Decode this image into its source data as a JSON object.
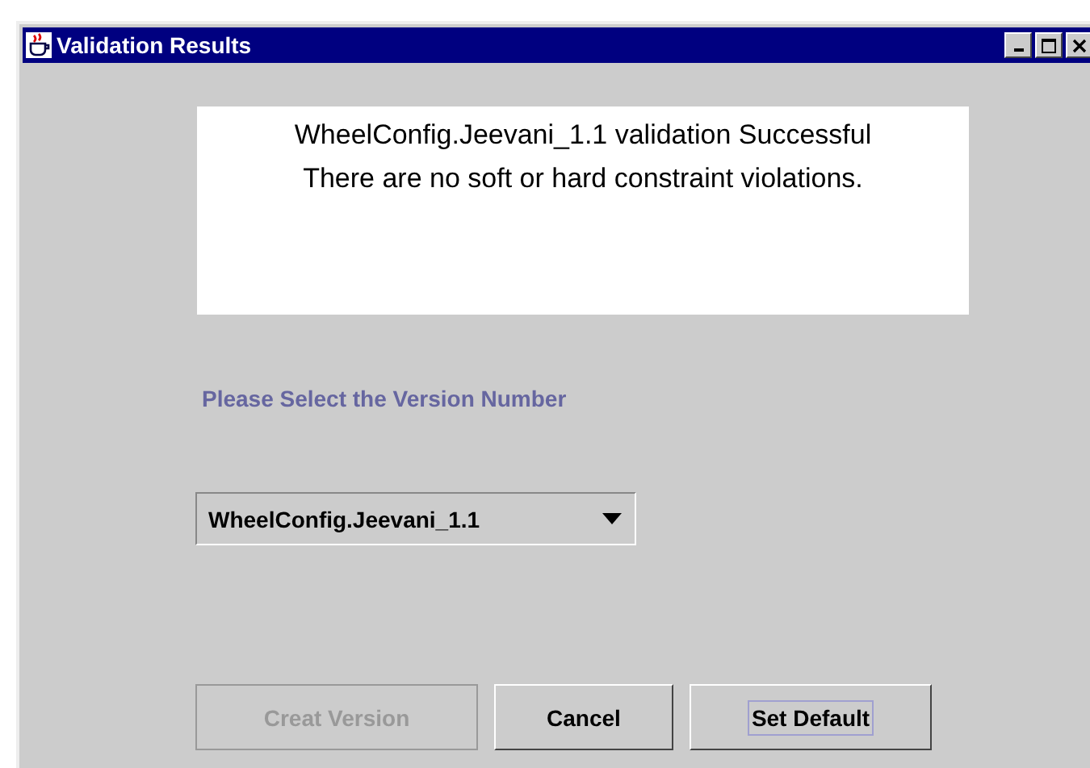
{
  "window": {
    "title": "Validation Results"
  },
  "message": [
    "WheelConfig.Jeevani_1.1 validation Successful",
    "There are no soft or hard constraint violations."
  ],
  "version_label": "Please Select the Version Number",
  "version_dropdown": {
    "value": "WheelConfig.Jeevani_1.1"
  },
  "buttons": [
    {
      "label": "Creat Version",
      "disabled": true,
      "focused": false
    },
    {
      "label": "Cancel",
      "disabled": false,
      "focused": false
    },
    {
      "label": "Set Default",
      "disabled": false,
      "focused": true
    }
  ]
}
